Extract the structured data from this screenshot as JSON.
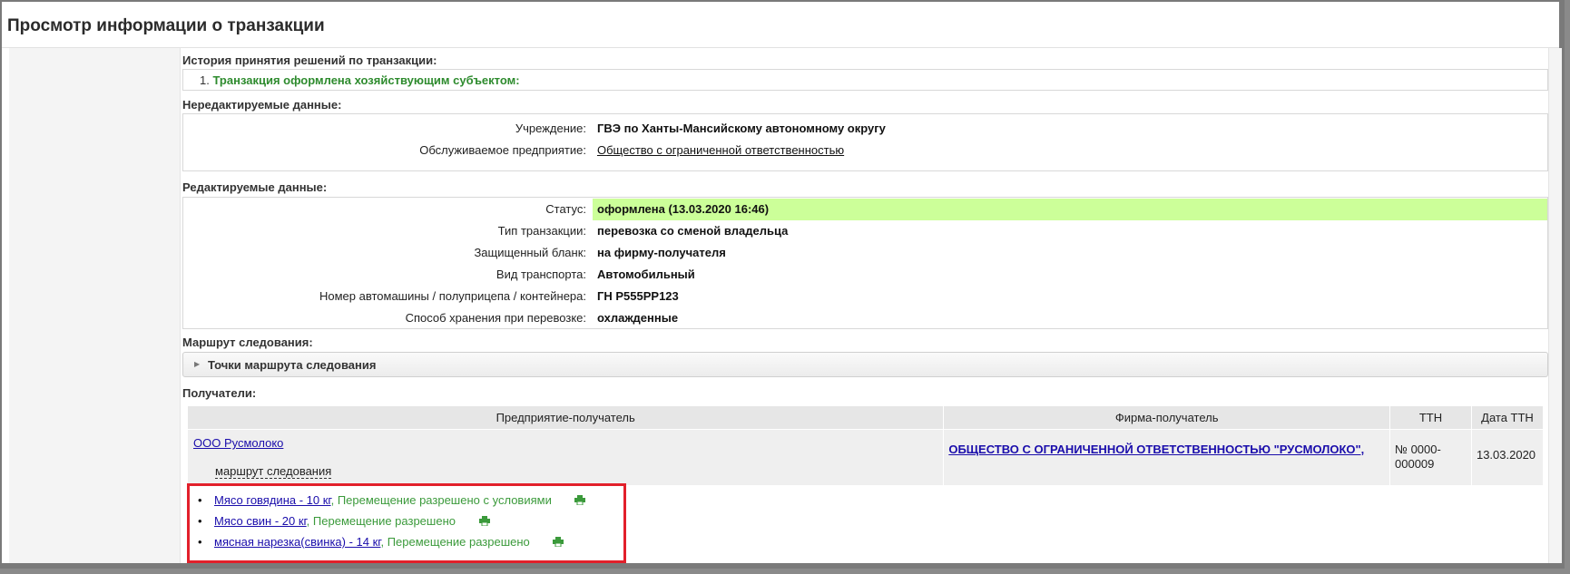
{
  "page": {
    "title": "Просмотр информации о транзакции"
  },
  "history": {
    "label": "История принятия решений по транзакции:",
    "items": [
      {
        "num": "1.",
        "text": "Транзакция оформлена хозяйствующим субъектом:"
      }
    ]
  },
  "readonly": {
    "label": "Нередактируемые данные:",
    "rows": [
      {
        "label": "Учреждение:",
        "value": "ГВЭ по Ханты-Мансийскому автономному округу"
      },
      {
        "label": "Обслуживаемое предприятие:",
        "value": "Общество с ограниченной ответственностью"
      }
    ]
  },
  "editable": {
    "label": "Редактируемые данные:",
    "rows": [
      {
        "label": "Статус:",
        "value": "оформлена (13.03.2020 16:46)"
      },
      {
        "label": "Тип транзакции:",
        "value": "перевозка со сменой владельца"
      },
      {
        "label": "Защищенный бланк:",
        "value": "на фирму-получателя"
      },
      {
        "label": "Вид транспорта:",
        "value": "Автомобильный"
      },
      {
        "label": "Номер автомашины / полуприцепа / контейнера:",
        "value": "ГН Р555РР123"
      },
      {
        "label": "Способ хранения при перевозке:",
        "value": "охлажденные"
      }
    ],
    "status_color": "#ccff99"
  },
  "route": {
    "label": "Маршрут следования:",
    "toggle_label": "Точки маршрута следования"
  },
  "recipients": {
    "label": "Получатели:",
    "headers": [
      "Предприятие-получатель",
      "Фирма-получатель",
      "ТТН",
      "Дата ТТН"
    ],
    "row": {
      "enterprise": "ООО Русмолоко",
      "route_link": "маршрут следования",
      "firm": "ОБЩЕСТВО С ОГРАНИЧЕННОЙ ОТВЕТСТВЕННОСТЬЮ \"РУСМОЛОКО\",",
      "ttn": "№ 0000-000009",
      "ttn_date": "13.03.2020"
    }
  },
  "goods": [
    {
      "name": "Мясо говядина - 10 кг",
      "status": "Перемещение разрешено с условиями",
      "icon": "print-icon"
    },
    {
      "name": "Мясо свин - 20 кг",
      "status": "Перемещение разрешено",
      "icon": "print-icon"
    },
    {
      "name": "мясная нарезка(свинка) - 14 кг",
      "status": "Перемещение разрешено",
      "icon": "print-icon"
    }
  ],
  "colors": {
    "highlight_border": "#e2202b",
    "status_green": "#3b9a3b",
    "link": "#1a0dab"
  }
}
